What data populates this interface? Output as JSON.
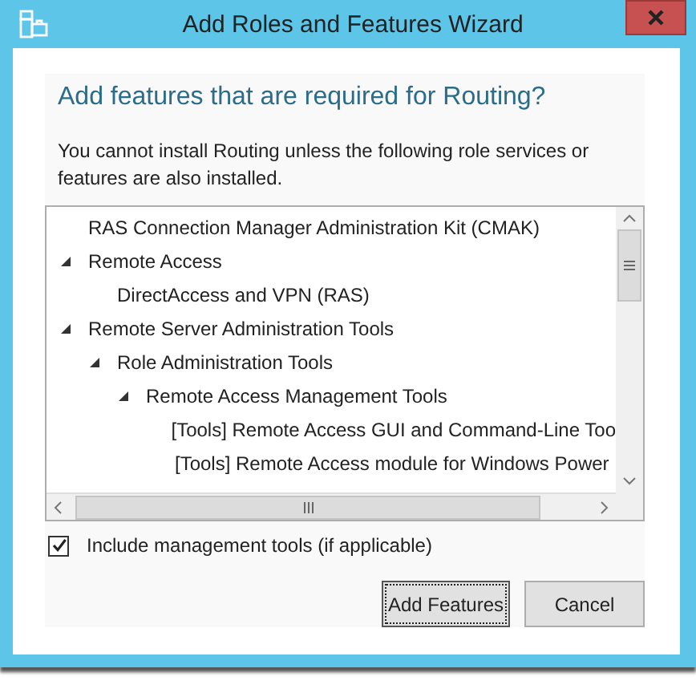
{
  "window": {
    "title": "Add Roles and Features Wizard"
  },
  "heading": "Add features that are required for Routing?",
  "message": "You cannot install Routing unless the following role services or features are also installed.",
  "tree": {
    "items": [
      {
        "label": "RAS Connection Manager Administration Kit (CMAK)"
      },
      {
        "label": "Remote Access",
        "expanded": true,
        "children": [
          {
            "label": "DirectAccess and VPN (RAS)"
          }
        ]
      },
      {
        "label": "Remote Server Administration Tools",
        "expanded": true,
        "children": [
          {
            "label": "Role Administration Tools",
            "expanded": true,
            "children": [
              {
                "label": "Remote Access Management Tools",
                "expanded": true,
                "children": [
                  {
                    "label": "[Tools] Remote Access GUI and Command-Line Too"
                  },
                  {
                    "label": "[Tools] Remote Access module for Windows Power"
                  }
                ]
              }
            ]
          }
        ]
      }
    ]
  },
  "include_tools": {
    "label": "Include management tools (if applicable)",
    "checked": true
  },
  "buttons": [
    {
      "label": "Add Features",
      "focused": true
    },
    {
      "label": "Cancel",
      "focused": false
    }
  ]
}
